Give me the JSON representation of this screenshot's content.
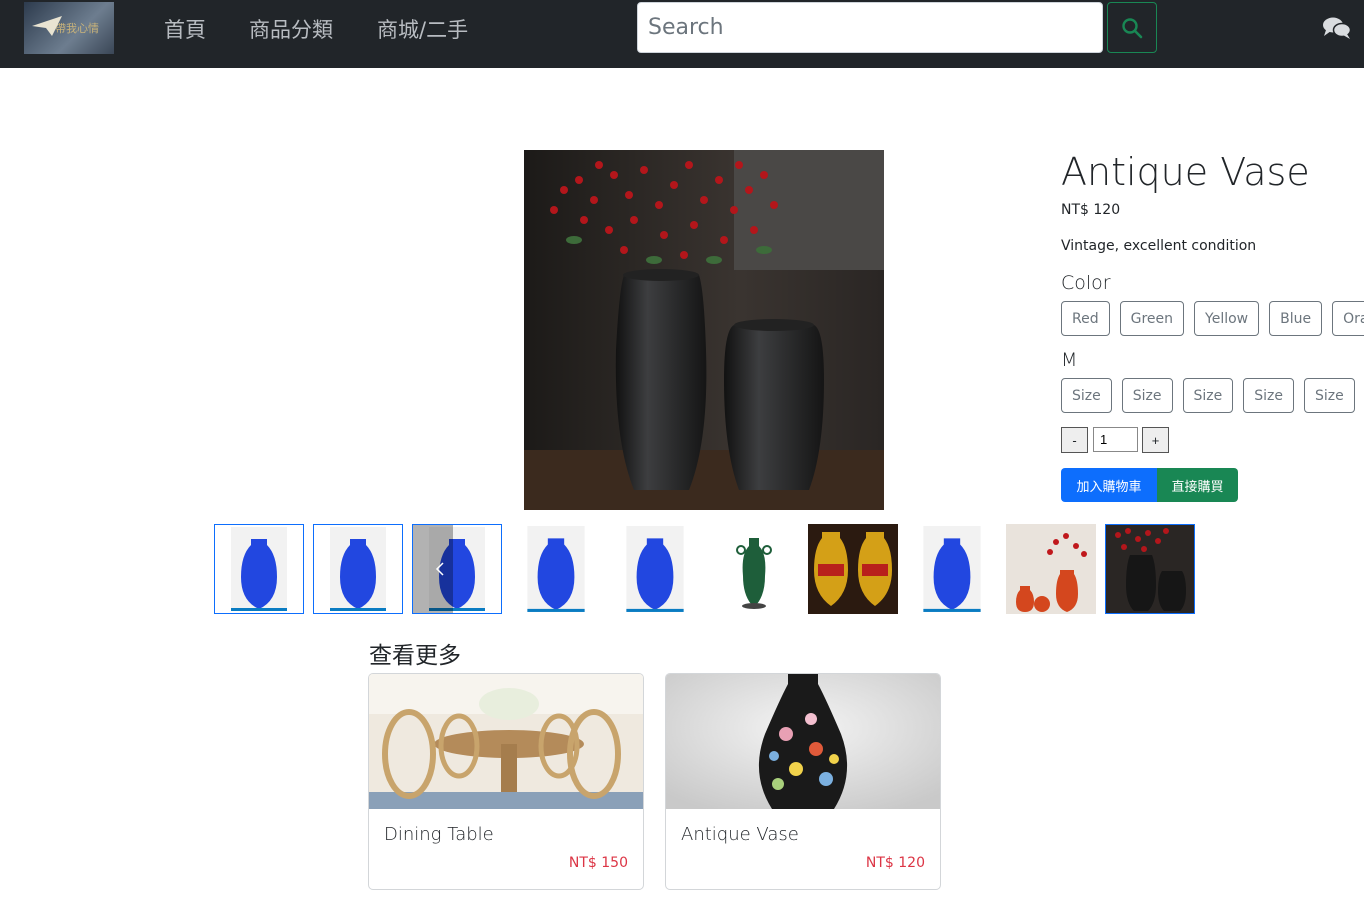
{
  "nav": {
    "logo_text": "帶我心情",
    "items": [
      {
        "label": "首頁"
      },
      {
        "label": "商品分類"
      },
      {
        "label": "商城/二手"
      }
    ],
    "search": {
      "placeholder": "Search"
    },
    "icons": {
      "search": "search-icon",
      "chat": "chat-icon"
    }
  },
  "product": {
    "title": "Antique Vase",
    "price": "NT$ 120",
    "description": "Vintage, excellent condition",
    "color_label": "Color",
    "colors": [
      "Red",
      "Green",
      "Yellow",
      "Blue",
      "Ora"
    ],
    "size_label": "M",
    "sizes": [
      "Size",
      "Size",
      "Size",
      "Size",
      "Size"
    ],
    "quantity": {
      "minus": "-",
      "value": "1",
      "plus": "+"
    },
    "add_to_cart": "加入購物車",
    "buy_now": "直接購買"
  },
  "colors": {
    "navbar": "#212529",
    "primary": "#0d6efd",
    "success": "#198754",
    "price_red": "#dc3545"
  },
  "more": {
    "title": "查看更多",
    "cards": [
      {
        "name": "Dining Table",
        "price": "NT$ 150"
      },
      {
        "name": "Antique Vase",
        "price": "NT$ 120"
      }
    ]
  }
}
